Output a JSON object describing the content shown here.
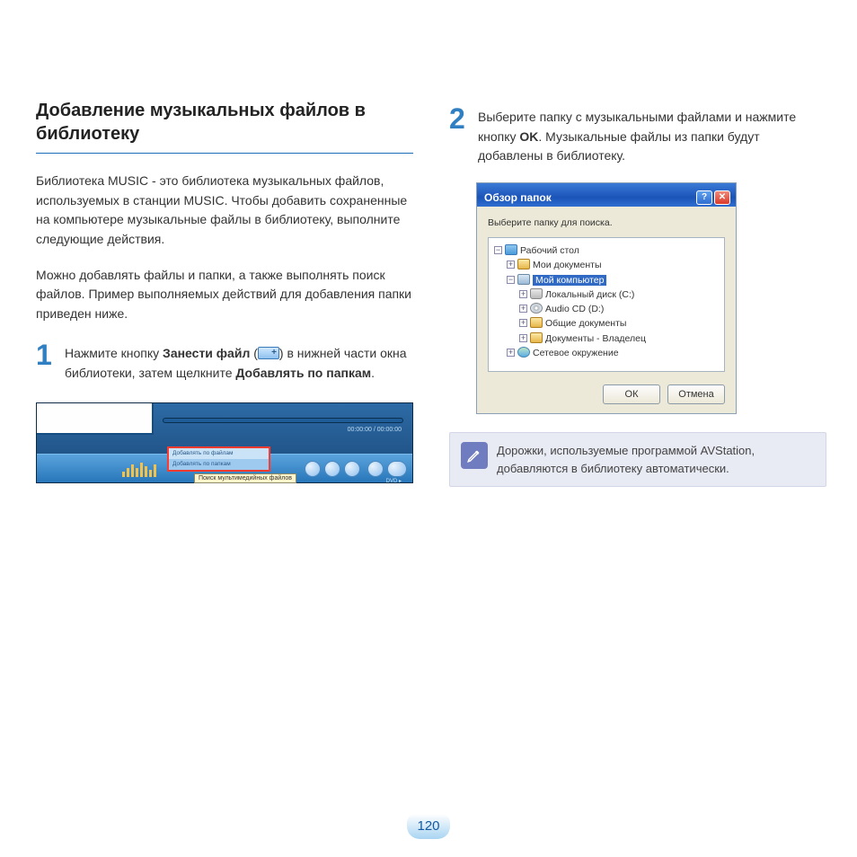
{
  "title": "Добавление музыкальных файлов в библиотеку",
  "intro_p1": "Библиотека MUSIC - это библиотека музыкальных файлов, используемых в станции MUSIC. Чтобы добавить сохраненные на компьютере музыкальные файлы в библиотеку, выполните следующие действия.",
  "intro_p2": "Можно добавлять файлы и папки, а также выполнять поиск файлов. Пример выполняемых действий для добавления папки приведен ниже.",
  "step1": {
    "num": "1",
    "pre": "Нажмите кнопку ",
    "bold1": "Занести файл",
    "mid": " (",
    "post": ") в нижней части окна библиотеки, затем щелкните ",
    "bold2": "Добавлять по папкам",
    "end": "."
  },
  "player": {
    "time": "00:00:00 / 00:00:00",
    "menu_item1": "Добавлять по файлам",
    "menu_item2": "Добавлять по папкам",
    "tooltip": "Поиск мультимедийных файлов",
    "dvd": "DVD ▸"
  },
  "step2": {
    "num": "2",
    "pre": "Выберите папку с музыкальными файлами и нажмите кнопку ",
    "bold": "OK",
    "post": ". Музыкальные файлы из папки будут добавлены в библиотеку."
  },
  "dialog": {
    "title": "Обзор папок",
    "label": "Выберите папку для поиска.",
    "tree": {
      "desktop": "Рабочий стол",
      "mydocs": "Мои документы",
      "mycomputer": "Мой компьютер",
      "localdisk": "Локальный диск (C:)",
      "audiocd": "Audio CD (D:)",
      "shared": "Общие документы",
      "ownerdocs": "Документы - Владелец",
      "network": "Сетевое окружение"
    },
    "ok": "ОК",
    "cancel": "Отмена",
    "help": "?",
    "close": "✕"
  },
  "note": "Дорожки, используемые программой AVStation, добавляются в библиотеку автоматически.",
  "page_number": "120"
}
